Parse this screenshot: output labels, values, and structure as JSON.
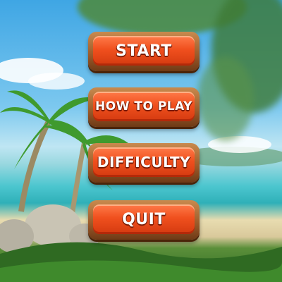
{
  "main_menu": {
    "buttons": [
      {
        "label": "START"
      },
      {
        "label": "HOW TO PLAY"
      },
      {
        "label": "DIFFICULTY"
      },
      {
        "label": "QUIT"
      }
    ]
  }
}
